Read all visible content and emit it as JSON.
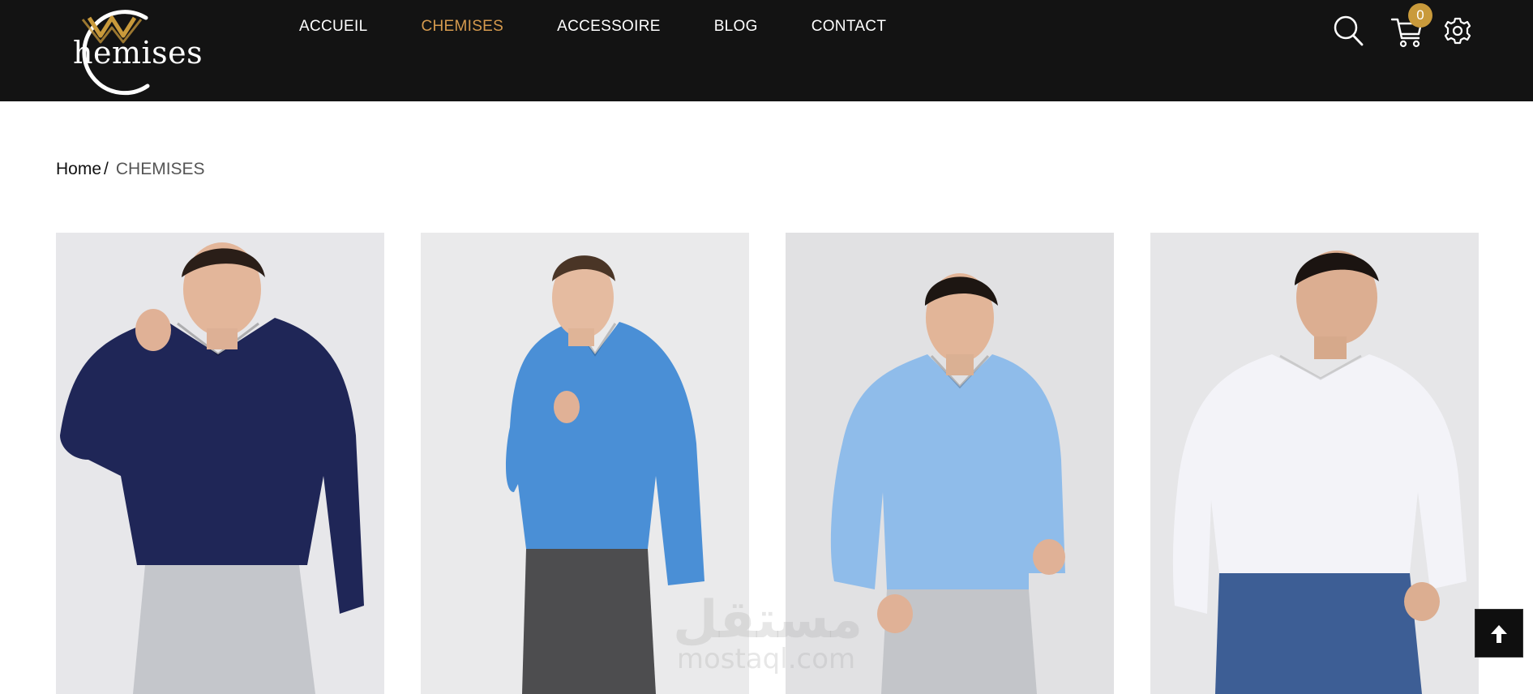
{
  "header": {
    "logo": {
      "text": "hemises",
      "accent_color": "#c99a3b"
    },
    "nav": [
      {
        "label": "ACCUEIL",
        "active": false
      },
      {
        "label": "CHEMISES",
        "active": true
      },
      {
        "label": "ACCESSOIRE",
        "active": false
      },
      {
        "label": "BLOG",
        "active": false
      },
      {
        "label": "CONTACT",
        "active": false
      }
    ],
    "nav_active_color": "#d59a4e",
    "icons": {
      "search": "search-icon",
      "cart": "cart-icon",
      "settings": "gear-icon"
    },
    "cart_count": "0"
  },
  "breadcrumb": {
    "home": "Home",
    "separator": "/",
    "current": "CHEMISES"
  },
  "products": [
    {
      "shirt_color": "#1f2657",
      "trouser_color": "#c4c6cb"
    },
    {
      "shirt_color": "#4a8fd6",
      "trouser_color": "#4d4d4f"
    },
    {
      "shirt_color": "#8fbcea",
      "trouser_color": "#c3c5c9"
    },
    {
      "shirt_color": "#f3f3f8",
      "trouser_color": "#3d5e95"
    }
  ],
  "watermark": {
    "arabic": "مستقل",
    "latin": "mostaql.com"
  },
  "back_to_top": {
    "icon": "arrow-up-icon"
  }
}
